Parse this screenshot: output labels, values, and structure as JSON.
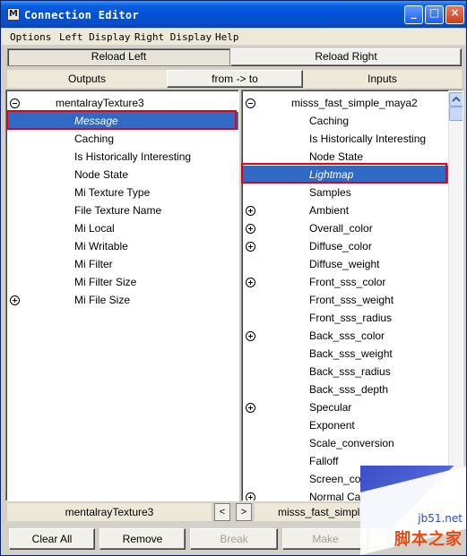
{
  "window": {
    "title": "Connection Editor",
    "app_icon": "maya-icon"
  },
  "menu": [
    "Options",
    "Left Display",
    "Right Display",
    "Help"
  ],
  "reload_left_label": "Reload Left",
  "reload_right_label": "Reload Right",
  "headers": {
    "outputs": "Outputs",
    "from_to": "from -> to",
    "inputs": "Inputs"
  },
  "left_panel": {
    "node": "mentalrayTexture3",
    "items": [
      "Message",
      "Caching",
      "Is Historically Interesting",
      "Node State",
      "Mi Texture Type",
      "File Texture Name",
      "Mi Local",
      "Mi Writable",
      "Mi Filter",
      "Mi Filter Size",
      "Mi File Size"
    ],
    "selected": "Message"
  },
  "right_panel": {
    "node": "misss_fast_simple_maya2",
    "items": [
      "Caching",
      "Is Historically Interesting",
      "Node State",
      "Lightmap",
      "Samples",
      "Ambient",
      "Overall_color",
      "Diffuse_color",
      "Diffuse_weight",
      "Front_sss_color",
      "Front_sss_weight",
      "Front_sss_radius",
      "Back_sss_color",
      "Back_sss_weight",
      "Back_sss_radius",
      "Back_sss_depth",
      "Specular",
      "Exponent",
      "Scale_conversion",
      "Falloff",
      "Screen_comp",
      "Normal Came"
    ],
    "selected": "Lightmap"
  },
  "footer": {
    "left_node": "mentalrayTexture3",
    "right_node": "misss_fast_simple",
    "prev": "<",
    "next": ">"
  },
  "buttons": {
    "clear_all": "Clear All",
    "remove": "Remove",
    "break": "Break",
    "make": "Make"
  },
  "watermark": {
    "url": "jb51.net",
    "text": "脚本之家"
  }
}
